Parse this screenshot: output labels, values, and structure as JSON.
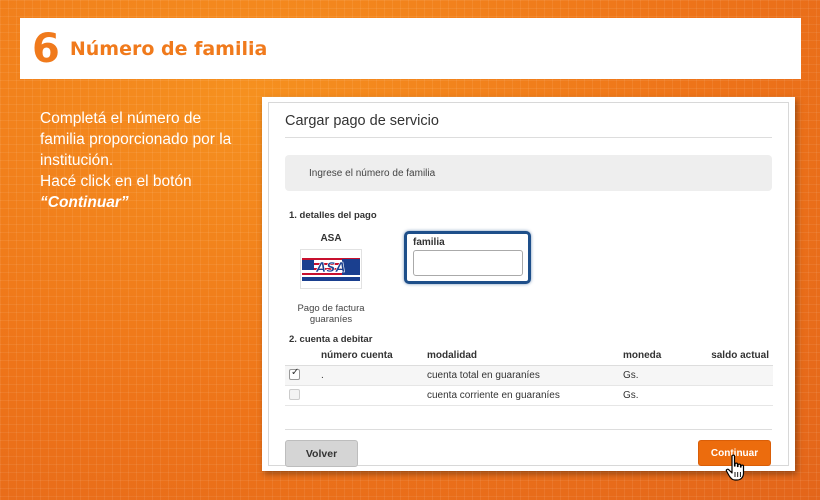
{
  "header": {
    "step_number": "6",
    "title": "Número de familia"
  },
  "instructions": {
    "line1": "Completá el número de familia proporcionado por la institución.",
    "line2": "Hacé click en el botón",
    "line3": "“Continuar”"
  },
  "panel": {
    "title": "Cargar pago de servicio",
    "info_text": "Ingrese el número de familia",
    "section1_label": "1. detalles del pago",
    "biller": {
      "name": "ASA",
      "logo_text": "ASA",
      "caption": "Pago de factura guaraníes"
    },
    "field": {
      "label": "familia",
      "value": "",
      "placeholder": ""
    },
    "section2_label": "2. cuenta a debitar",
    "table": {
      "headers": [
        "número cuenta",
        "modalidad",
        "moneda",
        "saldo actual"
      ],
      "rows": [
        {
          "checked": true,
          "account": ".",
          "modality": "cuenta total en guaraníes",
          "currency": "Gs.",
          "balance": ""
        },
        {
          "checked": false,
          "account": "",
          "modality": "cuenta corriente en guaraníes",
          "currency": "Gs.",
          "balance": ""
        }
      ]
    },
    "back_label": "Volver",
    "continue_label": "Continuar"
  },
  "colors": {
    "brand_orange": "#f07a1c",
    "button_orange": "#ec6c0d",
    "focus_blue": "#1e4f8a"
  },
  "icons": {
    "cursor": "hand-pointer-icon",
    "checkbox": "checkmark-icon"
  }
}
